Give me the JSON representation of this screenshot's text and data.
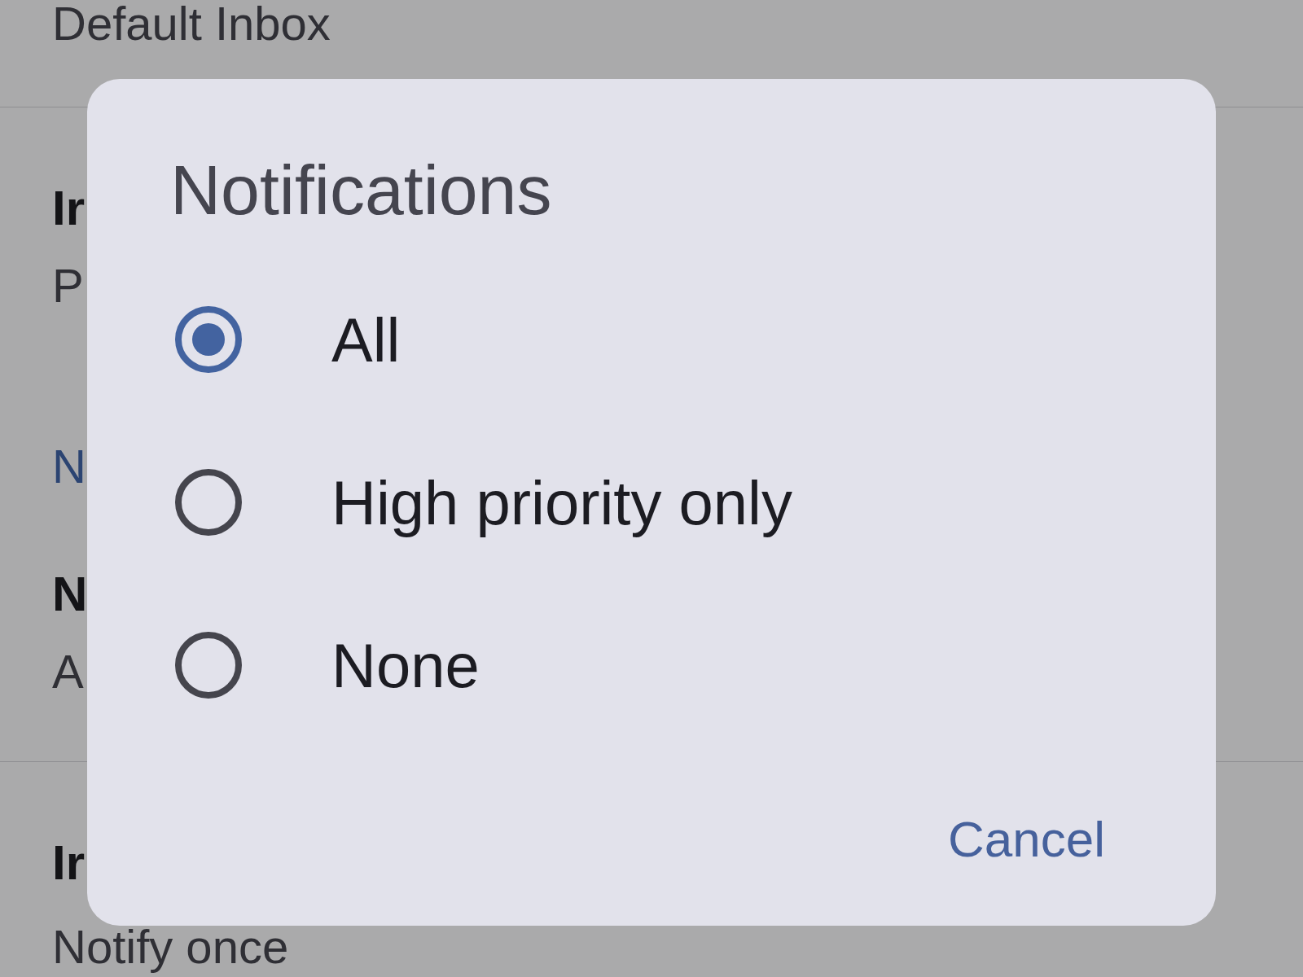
{
  "settings": {
    "sections": [
      {
        "items": [
          {
            "kind": "setting",
            "value": "Default Inbox"
          }
        ]
      },
      {
        "items": [
          {
            "kind": "setting",
            "title": "Ir",
            "value": "P"
          },
          {
            "kind": "header",
            "text": "N"
          },
          {
            "kind": "setting",
            "title": "N",
            "value": "A"
          }
        ]
      },
      {
        "items": [
          {
            "kind": "setting",
            "title": "Ir",
            "value": "Notify once"
          }
        ]
      }
    ]
  },
  "dialog": {
    "title": "Notifications",
    "options": [
      {
        "label": "All",
        "selected": true
      },
      {
        "label": "High priority only",
        "selected": false
      },
      {
        "label": "None",
        "selected": false
      }
    ],
    "buttons": [
      "Cancel"
    ]
  }
}
